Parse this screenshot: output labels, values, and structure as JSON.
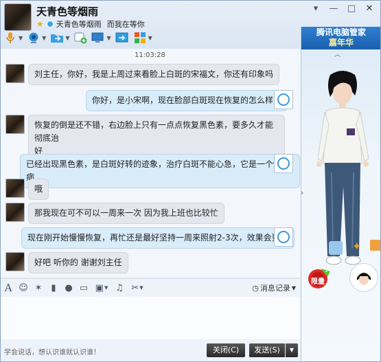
{
  "window": {
    "title": "天青色等烟雨",
    "status_name": "天青色等烟雨",
    "signature": "而我在等你",
    "controls": {
      "skin": "▾",
      "minimize": "—",
      "maximize": "□",
      "close": "✕"
    }
  },
  "toolbar": {
    "items": [
      {
        "name": "voice-call",
        "icon": "mic-icon"
      },
      {
        "name": "video-call",
        "icon": "camera-icon"
      },
      {
        "name": "file-transfer",
        "icon": "folder-icon"
      },
      {
        "name": "create-group",
        "icon": "add-contact-icon"
      },
      {
        "name": "remote-assist",
        "icon": "screen-icon"
      },
      {
        "name": "share-screen",
        "icon": "share-icon"
      },
      {
        "name": "apps",
        "icon": "apps-icon"
      }
    ]
  },
  "ad": {
    "line1": "腾讯电脑管家",
    "line2": "嘉年华",
    "collapse": "︿",
    "badge": "限量",
    "badge_num": "1"
  },
  "chat": {
    "timestamp": "11:03:28",
    "messages": [
      {
        "side": "left",
        "text": "刘主任，你好，我是上周过来看脸上白斑的宋福文，你还有印象吗"
      },
      {
        "side": "right",
        "text": "你好，是小宋啊，现在脸部白斑现在恢复的怎么样了"
      },
      {
        "side": "left",
        "text": "恢复的倒是还不错，右边脸上只有一点点恢复黑色素，要多久才能彻底治",
        "text2": "好"
      },
      {
        "side": "right",
        "text": "已经出现黑色素，是白斑好转的迹象，治疗白斑不能心急，它是一个慢性病"
      },
      {
        "side": "left",
        "text": "哦"
      },
      {
        "side": "left",
        "text": "那我现在可不可以一周来一次  因为我上班也比较忙"
      },
      {
        "side": "right",
        "text": "现在刚开始慢慢恢复，再忙还是最好坚持一周来照射2-3次，效果会更好"
      },
      {
        "side": "left",
        "text": "好吧   听你的  谢谢刘主任"
      }
    ]
  },
  "input": {
    "history_label": "消息记录",
    "placeholder_hint": "学会说话，想认识谁就认识谁！",
    "close_label": "关闭(C)",
    "send_label": "发送(S)",
    "send_dropdown": "▼"
  }
}
